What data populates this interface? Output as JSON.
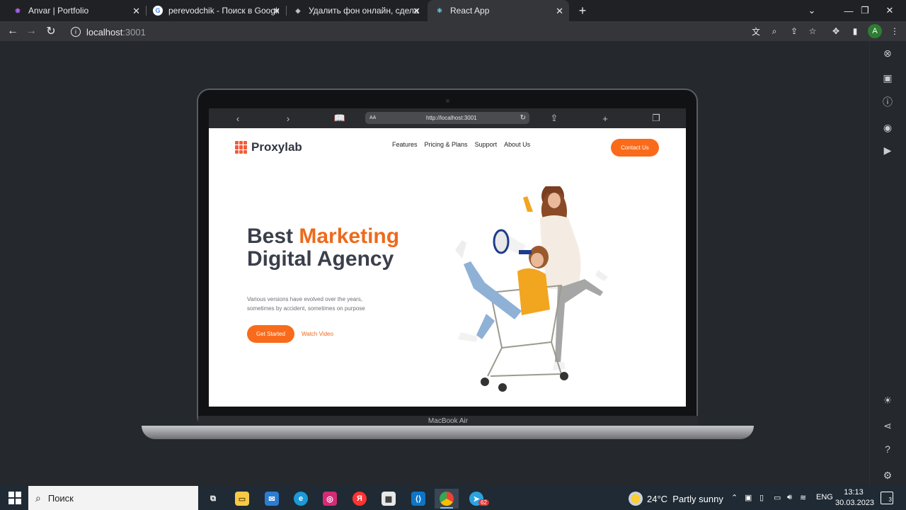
{
  "browser": {
    "tabs": [
      {
        "title": "Anvar | Portfolio",
        "icon": "portfolio-favicon-icon"
      },
      {
        "title": "perevodchik - Поиск в Google",
        "icon": "google-favicon-icon"
      },
      {
        "title": "Удалить фон онлайн, сделать пр",
        "icon": "removebg-favicon-icon"
      },
      {
        "title": "React App",
        "icon": "react-favicon-icon"
      }
    ],
    "new_tab": "+",
    "address_host": "localhost",
    "address_port": ":3001"
  },
  "device": {
    "safari_url": "http://localhost:3001",
    "safari_aa": "AA",
    "model_label": "MacBook Air"
  },
  "site": {
    "logo_text": "Proxylab",
    "nav": [
      "Features",
      "Pricing & Plans",
      "Support",
      "About Us"
    ],
    "contact_label": "Contact Us",
    "hero_title_1": "Best ",
    "hero_title_accent": "Marketing",
    "hero_title_2": "Digital Agency",
    "hero_subtitle": "Various versions have evolved over the years, sometimes by accident, sometimes on purpose",
    "cta_primary": "Get Started",
    "cta_secondary": "Watch Video",
    "accent_color": "#f96b1b"
  },
  "taskbar": {
    "search_placeholder": "Поиск",
    "weather_temp": "24°C",
    "weather_desc": "Partly sunny",
    "language": "ENG",
    "time": "13:13",
    "date": "30.03.2023",
    "telegram_badge": "62",
    "notifications": "3"
  }
}
